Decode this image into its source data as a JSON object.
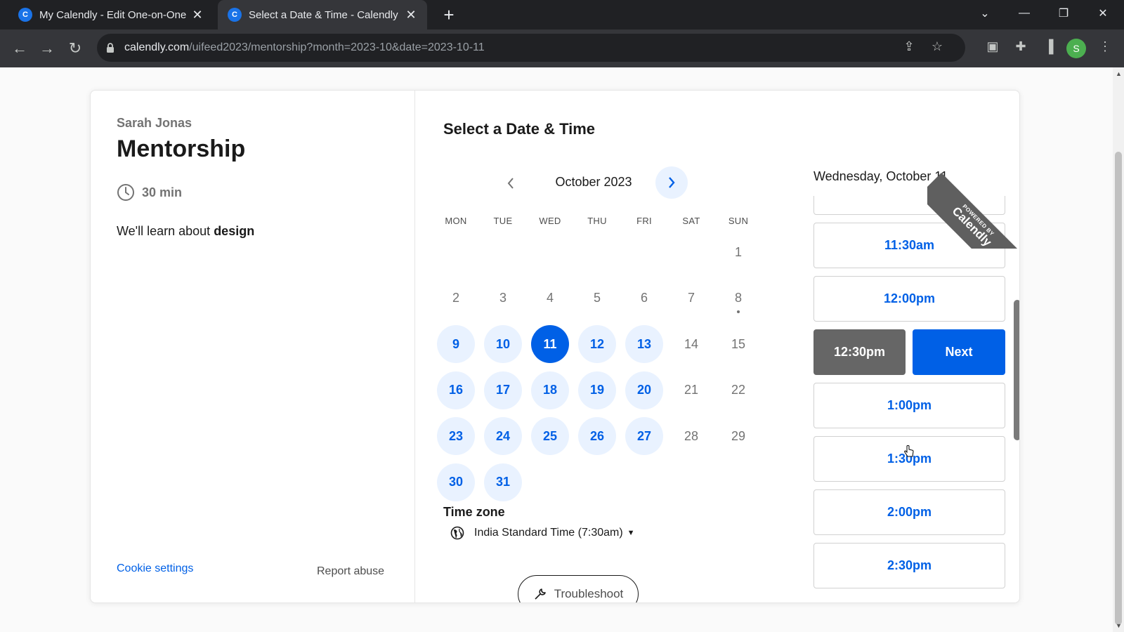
{
  "browser": {
    "tabs": [
      {
        "title": "My Calendly - Edit One-on-One",
        "active": false
      },
      {
        "title": "Select a Date & Time - Calendly",
        "active": true
      }
    ],
    "new_tab": "+",
    "url_host": "calendly.com",
    "url_path": "/uifeed2023/mentorship?month=2023-10&date=2023-10-11",
    "profile_initial": "S"
  },
  "event": {
    "owner": "Sarah Jonas",
    "title": "Mentorship",
    "duration": "30 min",
    "description_prefix": "We'll learn about ",
    "description_bold": "design",
    "cookie_settings": "Cookie settings",
    "report_abuse": "Report abuse"
  },
  "scheduler": {
    "heading": "Select a Date & Time",
    "month_label": "October 2023",
    "weekdays": [
      "MON",
      "TUE",
      "WED",
      "THU",
      "FRI",
      "SAT",
      "SUN"
    ],
    "days": [
      {
        "label": "1",
        "state": "plain"
      },
      {
        "label": "2",
        "state": "plain"
      },
      {
        "label": "3",
        "state": "plain"
      },
      {
        "label": "4",
        "state": "plain"
      },
      {
        "label": "5",
        "state": "plain"
      },
      {
        "label": "6",
        "state": "plain"
      },
      {
        "label": "7",
        "state": "plain"
      },
      {
        "label": "8",
        "state": "plain",
        "today": true
      },
      {
        "label": "9",
        "state": "available"
      },
      {
        "label": "10",
        "state": "available"
      },
      {
        "label": "11",
        "state": "selected"
      },
      {
        "label": "12",
        "state": "available"
      },
      {
        "label": "13",
        "state": "available"
      },
      {
        "label": "14",
        "state": "plain"
      },
      {
        "label": "15",
        "state": "plain"
      },
      {
        "label": "16",
        "state": "available"
      },
      {
        "label": "17",
        "state": "available"
      },
      {
        "label": "18",
        "state": "available"
      },
      {
        "label": "19",
        "state": "available"
      },
      {
        "label": "20",
        "state": "available"
      },
      {
        "label": "21",
        "state": "plain"
      },
      {
        "label": "22",
        "state": "plain"
      },
      {
        "label": "23",
        "state": "available"
      },
      {
        "label": "24",
        "state": "available"
      },
      {
        "label": "25",
        "state": "available"
      },
      {
        "label": "26",
        "state": "available"
      },
      {
        "label": "27",
        "state": "available"
      },
      {
        "label": "28",
        "state": "plain"
      },
      {
        "label": "29",
        "state": "plain"
      },
      {
        "label": "30",
        "state": "available"
      },
      {
        "label": "31",
        "state": "available"
      }
    ],
    "timezone_label": "Time zone",
    "timezone_value": "India Standard Time (7:30am)",
    "troubleshoot": "Troubleshoot",
    "selected_date": "Wednesday, October 11",
    "slots": [
      "",
      "11:30am",
      "12:00pm",
      "12:30pm",
      "1:00pm",
      "1:30pm",
      "2:00pm",
      "2:30pm"
    ],
    "selected_slot": "12:30pm",
    "next_label": "Next"
  },
  "badge": {
    "powered_by": "POWERED BY",
    "brand": "Calendly"
  },
  "colors": {
    "accent": "#0060e6",
    "available_bg": "#e9f2ff",
    "selected_slot_bg": "#666666"
  }
}
